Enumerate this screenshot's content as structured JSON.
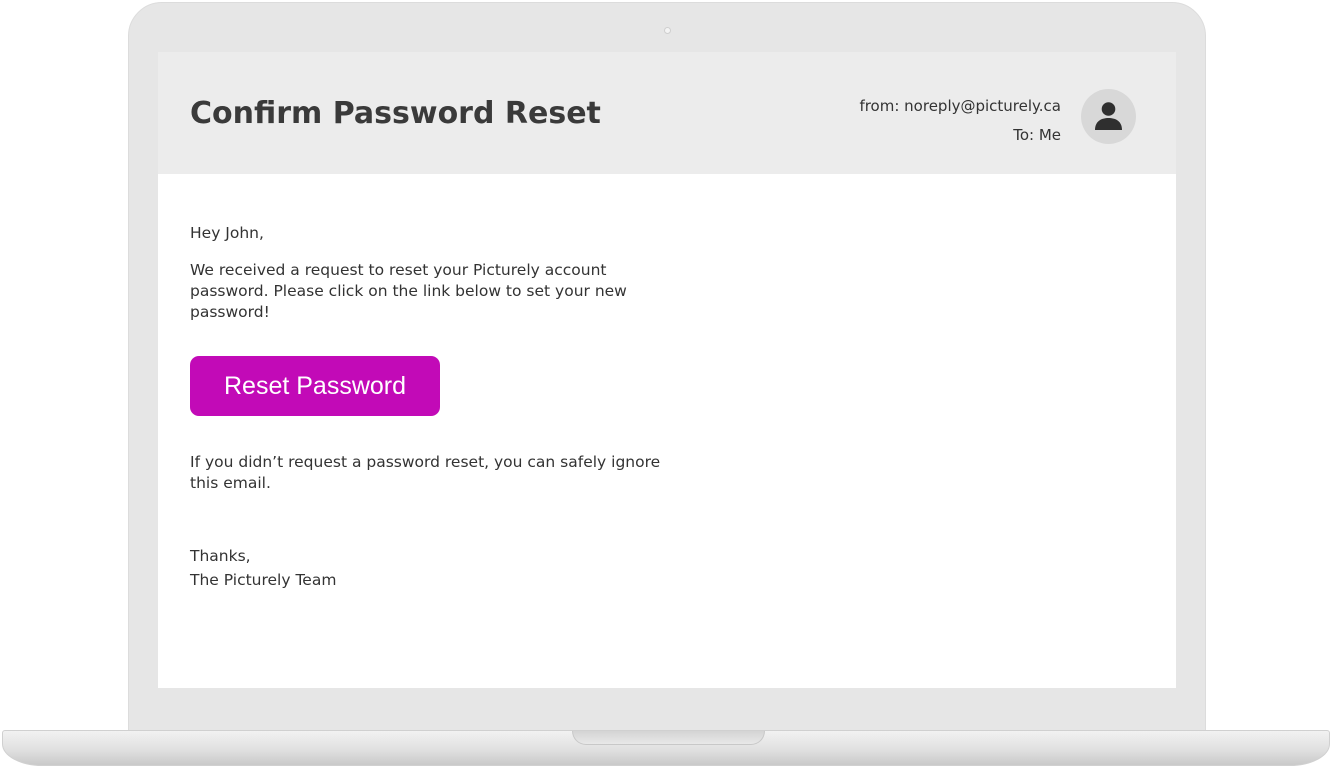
{
  "email": {
    "subject": "Confirm Password Reset",
    "from": "from: noreply@picturely.ca",
    "to": "To: Me",
    "avatar_icon": "user-icon",
    "greeting": "Hey John,",
    "message": "We received a request to reset your Picturely account password. Please click on the link below to set your new password!",
    "button_label": "Reset Password",
    "ignore_note": "If you didn’t request a password reset, you can safely ignore this email.",
    "signoff_line1": "Thanks,",
    "signoff_line2": "The Picturely Team"
  },
  "colors": {
    "button": "#c20ab7",
    "header_background": "#ececec",
    "device_frame": "#e6e6e6"
  }
}
